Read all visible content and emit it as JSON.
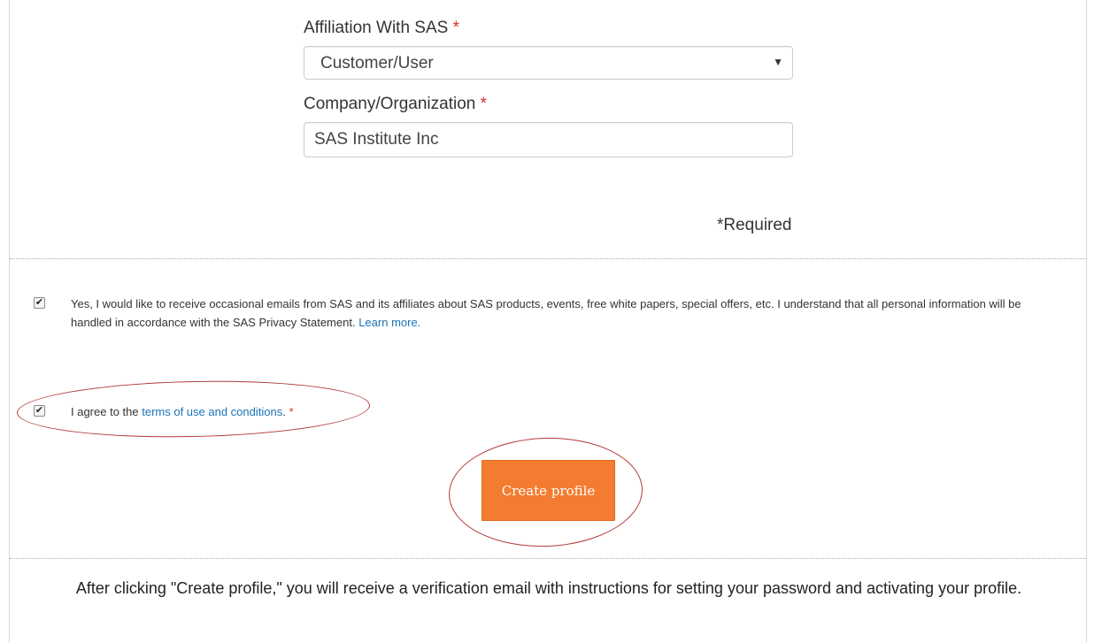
{
  "form": {
    "affiliation": {
      "label": "Affiliation With SAS",
      "required_mark": "*",
      "selected_value": "Customer/User",
      "caret": "▼"
    },
    "company": {
      "label": "Company/Organization",
      "required_mark": "*",
      "value": "SAS Institute Inc"
    },
    "required_note": "*Required"
  },
  "consent": {
    "newsletter": {
      "checked_glyph": "✔",
      "text": "Yes, I would like to receive occasional emails from SAS and its affiliates about SAS products, events, free white papers, special offers, etc. I understand that all personal information will be handled in accordance with the SAS Privacy Statement.",
      "link_text": "Learn more."
    },
    "terms": {
      "checked_glyph": "✔",
      "prefix": "I agree to the ",
      "link_text": "terms of use and conditions",
      "suffix": ".",
      "required_mark": "*"
    }
  },
  "actions": {
    "create_label": "Create profile"
  },
  "footer": {
    "note": "After clicking \"Create profile,\" you will receive a verification email with instructions for setting your password and activating your profile."
  },
  "colors": {
    "accent_button": "#f47c30",
    "link": "#1a73b8",
    "required": "#cc3333",
    "annotation": "#b23a3a"
  }
}
